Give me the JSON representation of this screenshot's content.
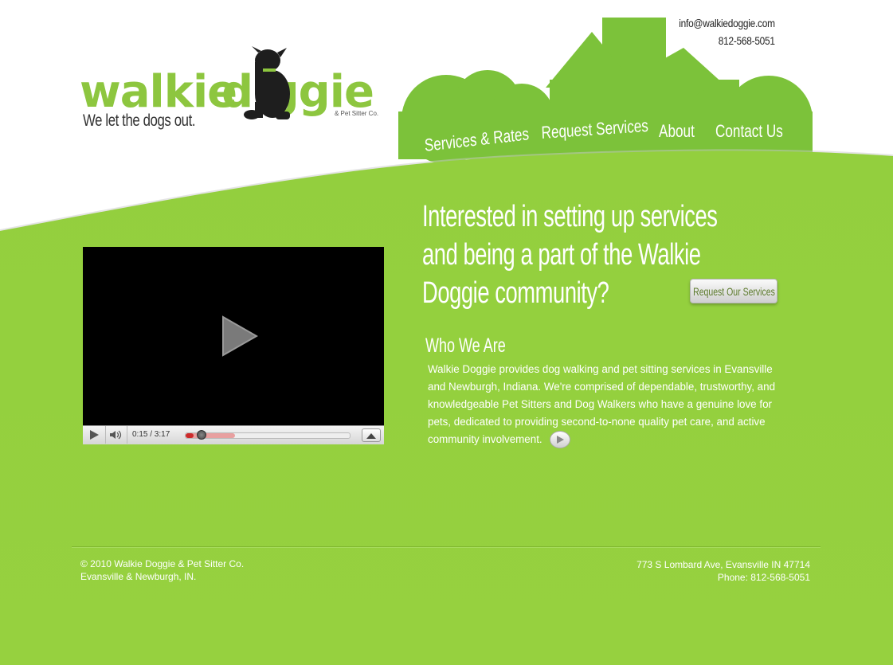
{
  "colors": {
    "brand_green": "#8dc63f",
    "background_green": "#93cf3e",
    "text_dark": "#222222"
  },
  "header": {
    "email": "info@walkiedoggie.com",
    "phone": "812-568-5051"
  },
  "logo": {
    "word_1": "walkie",
    "word_2": "d ggie",
    "small_text": "& Pet Sitter Co.",
    "tagline": "We let the dogs out."
  },
  "nav": {
    "items": [
      {
        "label": "Services & Rates"
      },
      {
        "label": "Request Services"
      },
      {
        "label": "About"
      },
      {
        "label": "Contact Us"
      }
    ]
  },
  "video": {
    "time_text": "0:15 / 3:17",
    "progress": 0.05,
    "buffered": 0.3,
    "icons": [
      "play-icon",
      "volume-icon",
      "fullscreen-icon"
    ]
  },
  "main": {
    "headline": "Interested in setting up services and being a part of the Walkie Doggie community?",
    "request_button": "Request Our Services",
    "who_title": "Who We Are",
    "who_text": "Walkie Doggie provides dog walking and pet sitting services in Evansville and Newburgh, Indiana. We're comprised of dependable, trustworthy, and knowledgeable Pet Sitters and Dog Walkers who have a genuine love for pets, dedicated to providing second-to-none quality pet care, and active community involvement."
  },
  "footer": {
    "copyright": "© 2010 Walkie Doggie & Pet Sitter Co.",
    "locations": "Evansville & Newburgh, IN.",
    "address": "773 S Lombard Ave, Evansville IN 47714",
    "phone": "Phone: 812-568-5051"
  }
}
